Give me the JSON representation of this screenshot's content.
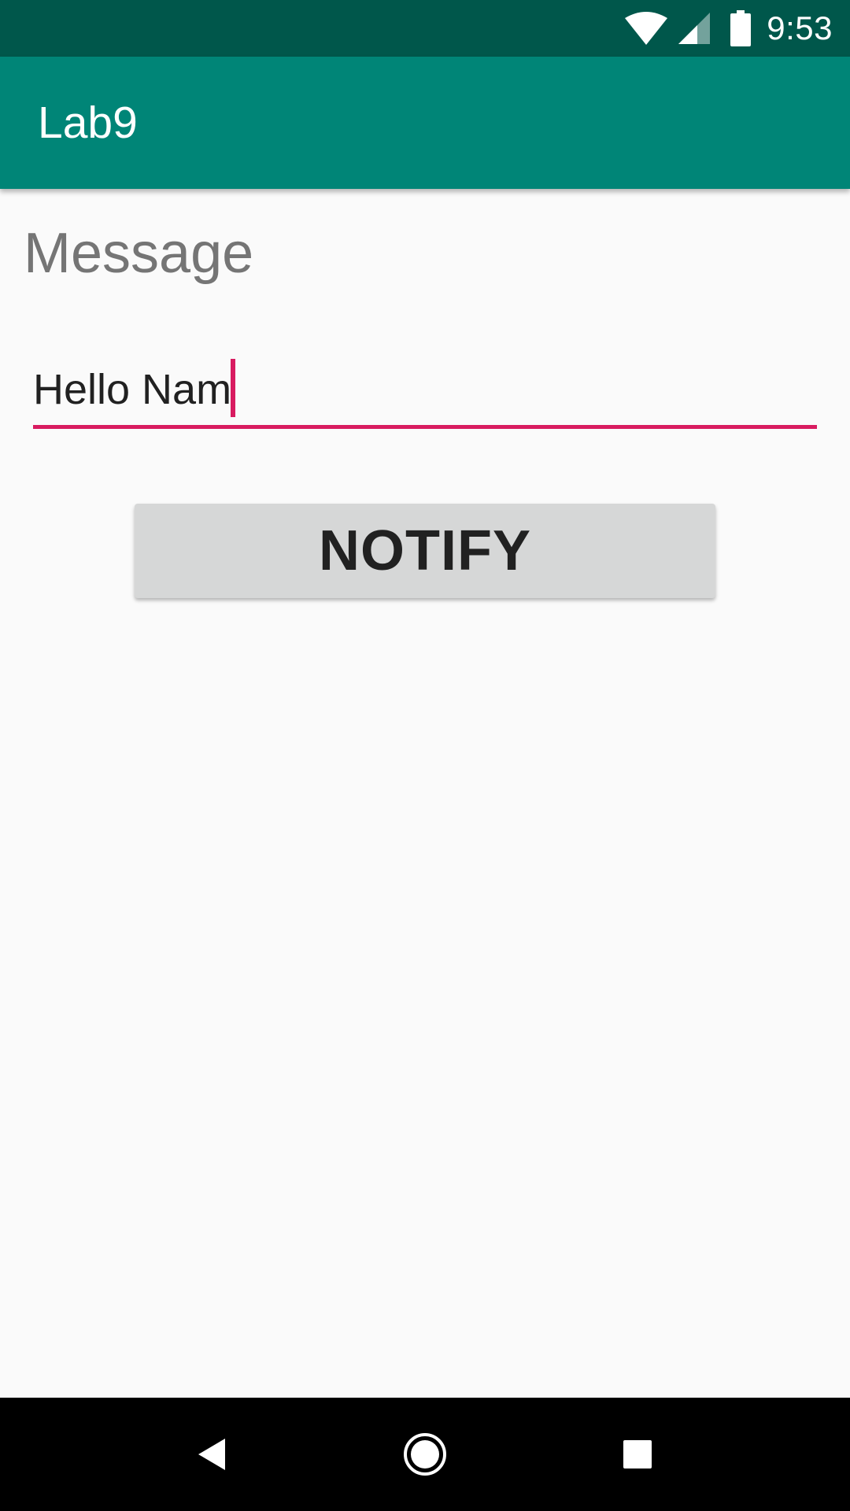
{
  "status_bar": {
    "time": "9:53",
    "icons": [
      "wifi-icon",
      "cell-signal-icon",
      "battery-icon"
    ],
    "background": "#00574b"
  },
  "app_bar": {
    "title": "Lab9",
    "background": "#008577"
  },
  "form": {
    "label": "Message",
    "input_value": "Hello Nam",
    "accent_color": "#d81b60"
  },
  "actions": {
    "notify_label": "NOTIFY"
  },
  "nav_bar": {
    "buttons": [
      "back-icon",
      "home-icon",
      "recents-icon"
    ]
  }
}
